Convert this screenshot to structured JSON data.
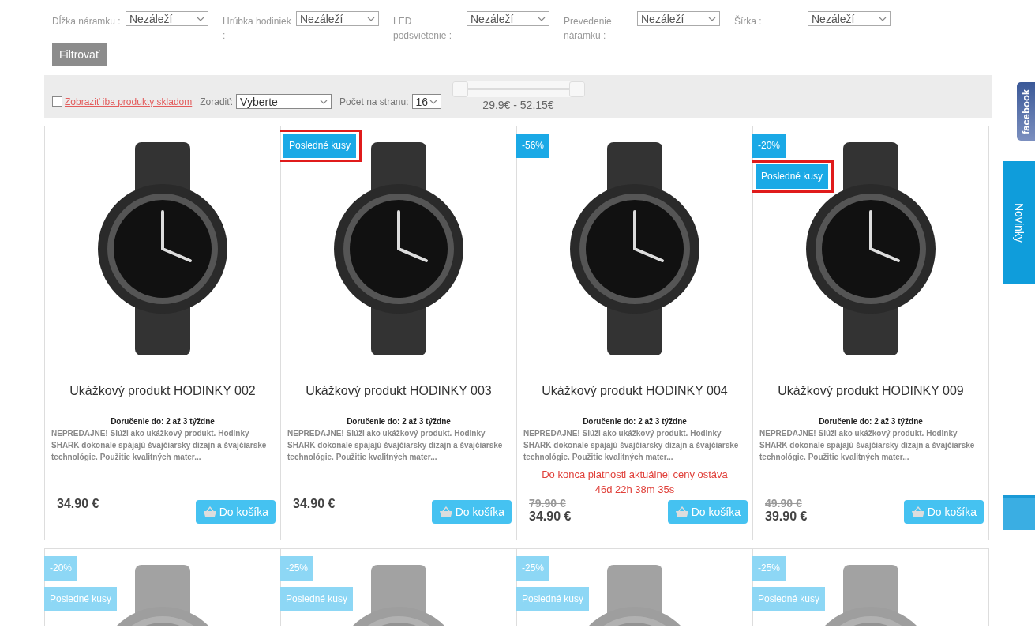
{
  "filters": [
    {
      "label": "Dĺžka náramku :",
      "value": "Nezáleží"
    },
    {
      "label": "Hrúbka hodiniek :",
      "value": "Nezáleží"
    },
    {
      "label": "LED podsvietenie :",
      "value": "Nezáleží"
    },
    {
      "label": "Prevedenie náramku :",
      "value": "Nezáleží"
    },
    {
      "label": "Šírka :",
      "value": "Nezáleží"
    }
  ],
  "filter_button": "Filtrovať",
  "toolbar": {
    "stock_only": {
      "label": "Zobraziť iba produkty skladom",
      "checked": false
    },
    "sort": {
      "label": "Zoradiť:",
      "value": "Vyberte"
    },
    "per_page": {
      "label": "Počet na stranu:",
      "value": "16"
    },
    "price_slider": {
      "level": 1
    },
    "price_range": "29.9€ - 52.15€"
  },
  "products": [
    {
      "faded": false,
      "title": "Ukážkový produkt HODINKY 002",
      "delivery": "Doručenie do: 2 až 3 týždne",
      "description": "NEPREDAJNE! Slúži ako ukážkový produkt. Hodinky SHARK dokonale spájajú švajčiarsky dizajn a švajčiarske technológie. Použitie kvalitných mater...",
      "price": "34.90 €",
      "button": "Do košíka"
    },
    {
      "faded": false,
      "last_items": "Posledné kusy",
      "highlighted": true,
      "title": "Ukážkový produkt HODINKY 003",
      "delivery": "Doručenie do: 2 až 3 týždne",
      "description": "NEPREDAJNE! Slúži ako ukážkový produkt. Hodinky SHARK dokonale spájajú švajčiarsky dizajn a švajčiarske technológie. Použitie kvalitných mater...",
      "price": "34.90 €",
      "button": "Do košíka"
    },
    {
      "faded": false,
      "discount": "-56%",
      "title": "Ukážkový produkt HODINKY 004",
      "delivery": "Doručenie do: 2 až 3 týždne",
      "description": "NEPREDAJNE! Slúži ako ukážkový produkt. Hodinky SHARK dokonale spájajú švajčiarsky dizajn a švajčiarske technológie. Použitie kvalitných mater...",
      "countdown": "Do konca platnosti aktuálnej ceny ostáva 46d 22h 38m 35s",
      "old_price": "79.90 €",
      "price": "34.90 €",
      "button": "Do košíka"
    },
    {
      "faded": false,
      "discount": "-20%",
      "last_items": "Posledné kusy",
      "highlighted": true,
      "title": "Ukážkový produkt HODINKY 009",
      "delivery": "Doručenie do: 2 až 3 týždne",
      "description": "NEPREDAJNE! Slúži ako ukážkový produkt. Hodinky SHARK dokonale spájajú švajčiarsky dizajn a švajčiarske technológie. Použitie kvalitných mater...",
      "old_price": "49.90 €",
      "price": "39.90 €",
      "button": "Do košíka"
    },
    {
      "faded": true,
      "discount": "-20%",
      "last_items": "Posledné kusy",
      "highlighted": false
    },
    {
      "faded": true,
      "discount": "-25%",
      "last_items": "Posledné kusy",
      "highlighted": false
    },
    {
      "faded": true,
      "discount": "-25%",
      "last_items": "Posledné kusy",
      "highlighted": false
    },
    {
      "faded": true,
      "discount": "-25%",
      "last_items": "Posledné kusy",
      "highlighted": false
    }
  ],
  "side_tabs": {
    "facebook": "facebook",
    "news": "Novinky"
  }
}
